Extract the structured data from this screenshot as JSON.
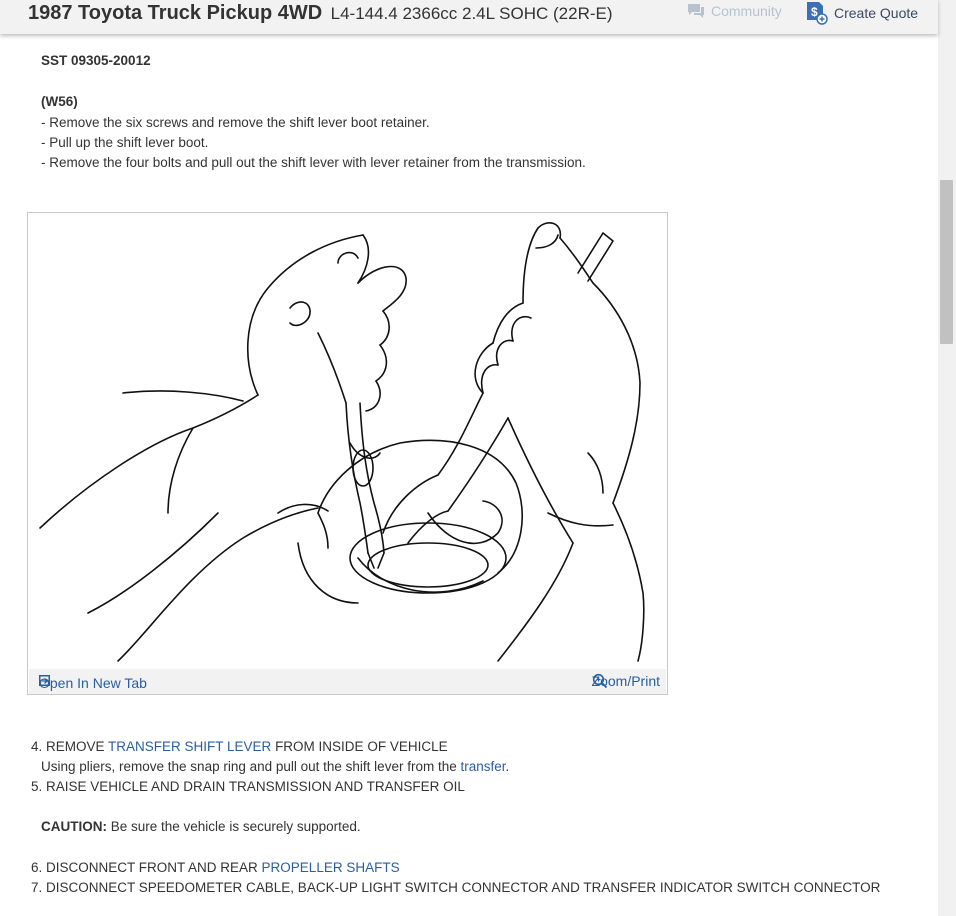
{
  "header": {
    "vehicle_model": "1987 Toyota Truck Pickup 4WD",
    "engine": "L4-144.4 2366cc 2.4L SOHC (22R-E)",
    "community_label": "Community",
    "quote_label": "Create Quote"
  },
  "content": {
    "sst": "SST 09305-20012",
    "w56_heading": "(W56)",
    "w56_steps": [
      "-  Remove the six screws and remove the shift lever boot retainer.",
      "-  Pull up the shift lever boot.",
      "-  Remove the four bolts and pull out the shift lever with lever retainer from the transmission."
    ],
    "figure": {
      "open_tab_label": "Open In New Tab",
      "zoom_label": "Zoom/Print"
    },
    "step4": {
      "prefix": "4. REMOVE ",
      "link": "TRANSFER SHIFT LEVER",
      "suffix": " FROM INSIDE OF VEHICLE",
      "detail_prefix": "Using pliers, remove the snap ring and pull out the shift lever from the ",
      "detail_link": "transfer",
      "detail_suffix": "."
    },
    "step5": "5. RAISE VEHICLE AND DRAIN TRANSMISSION AND TRANSFER OIL",
    "caution_label": "CAUTION:",
    "caution_text": " Be sure the vehicle is securely supported.",
    "step6": {
      "prefix": "6. DISCONNECT FRONT AND REAR ",
      "link": "PROPELLER SHAFTS",
      "suffix": ""
    },
    "step7": "7. DISCONNECT SPEEDOMETER CABLE, BACK-UP LIGHT SWITCH CONNECTOR AND TRANSFER INDICATOR SWITCH CONNECTOR"
  },
  "icons": {
    "community": "chat-bubble-icon",
    "quote": "dollar-document-icon",
    "open_tab": "open-external-icon",
    "zoom": "magnifier-icon"
  },
  "colors": {
    "link": "#2a5e9e",
    "header_bg": "#f2f2f2",
    "text": "#333333"
  }
}
